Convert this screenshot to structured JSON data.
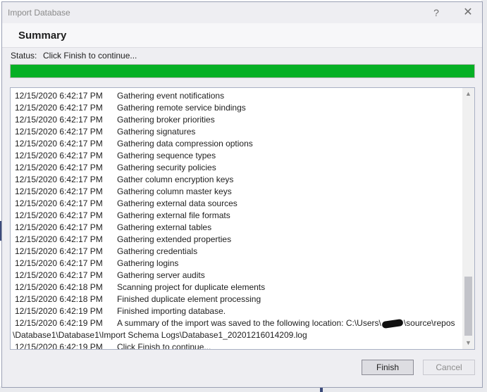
{
  "window": {
    "title": "Import Database",
    "help_icon": "?",
    "close_icon": "✕"
  },
  "header": {
    "title": "Summary"
  },
  "status": {
    "label": "Status:",
    "text": "Click Finish to continue...",
    "progress": 1.0,
    "progress_color": "#06b025"
  },
  "log": {
    "rows": [
      {
        "time": "12/15/2020 6:42:17 PM",
        "message": "Gathering event notifications"
      },
      {
        "time": "12/15/2020 6:42:17 PM",
        "message": "Gathering remote service bindings"
      },
      {
        "time": "12/15/2020 6:42:17 PM",
        "message": "Gathering broker priorities"
      },
      {
        "time": "12/15/2020 6:42:17 PM",
        "message": "Gathering signatures"
      },
      {
        "time": "12/15/2020 6:42:17 PM",
        "message": "Gathering data compression options"
      },
      {
        "time": "12/15/2020 6:42:17 PM",
        "message": "Gathering sequence types"
      },
      {
        "time": "12/15/2020 6:42:17 PM",
        "message": "Gathering security policies"
      },
      {
        "time": "12/15/2020 6:42:17 PM",
        "message": "Gather column encryption keys"
      },
      {
        "time": "12/15/2020 6:42:17 PM",
        "message": "Gathering column master keys"
      },
      {
        "time": "12/15/2020 6:42:17 PM",
        "message": "Gathering external data sources"
      },
      {
        "time": "12/15/2020 6:42:17 PM",
        "message": "Gathering external file formats"
      },
      {
        "time": "12/15/2020 6:42:17 PM",
        "message": "Gathering external tables"
      },
      {
        "time": "12/15/2020 6:42:17 PM",
        "message": "Gathering extended properties"
      },
      {
        "time": "12/15/2020 6:42:17 PM",
        "message": "Gathering credentials"
      },
      {
        "time": "12/15/2020 6:42:17 PM",
        "message": "Gathering logins"
      },
      {
        "time": "12/15/2020 6:42:17 PM",
        "message": "Gathering server audits"
      },
      {
        "time": "12/15/2020 6:42:18 PM",
        "message": "Scanning project for duplicate elements"
      },
      {
        "time": "12/15/2020 6:42:18 PM",
        "message": "Finished duplicate element processing"
      },
      {
        "time": "12/15/2020 6:42:19 PM",
        "message": "Finished importing database."
      }
    ],
    "summary_row": {
      "time": "12/15/2020 6:42:19 PM",
      "message_before": "A summary of the import was saved to the following location: C:\\Users\\",
      "message_after": "\\source\\repos",
      "continuation": "\\Database1\\Database1\\Import Schema Logs\\Database1_20201216014209.log"
    },
    "last_row": {
      "time": "12/15/2020 6:42:19 PM",
      "message": "Click Finish to continue..."
    },
    "scroll_position": 0.85
  },
  "buttons": {
    "finish": "Finish",
    "cancel": "Cancel"
  }
}
